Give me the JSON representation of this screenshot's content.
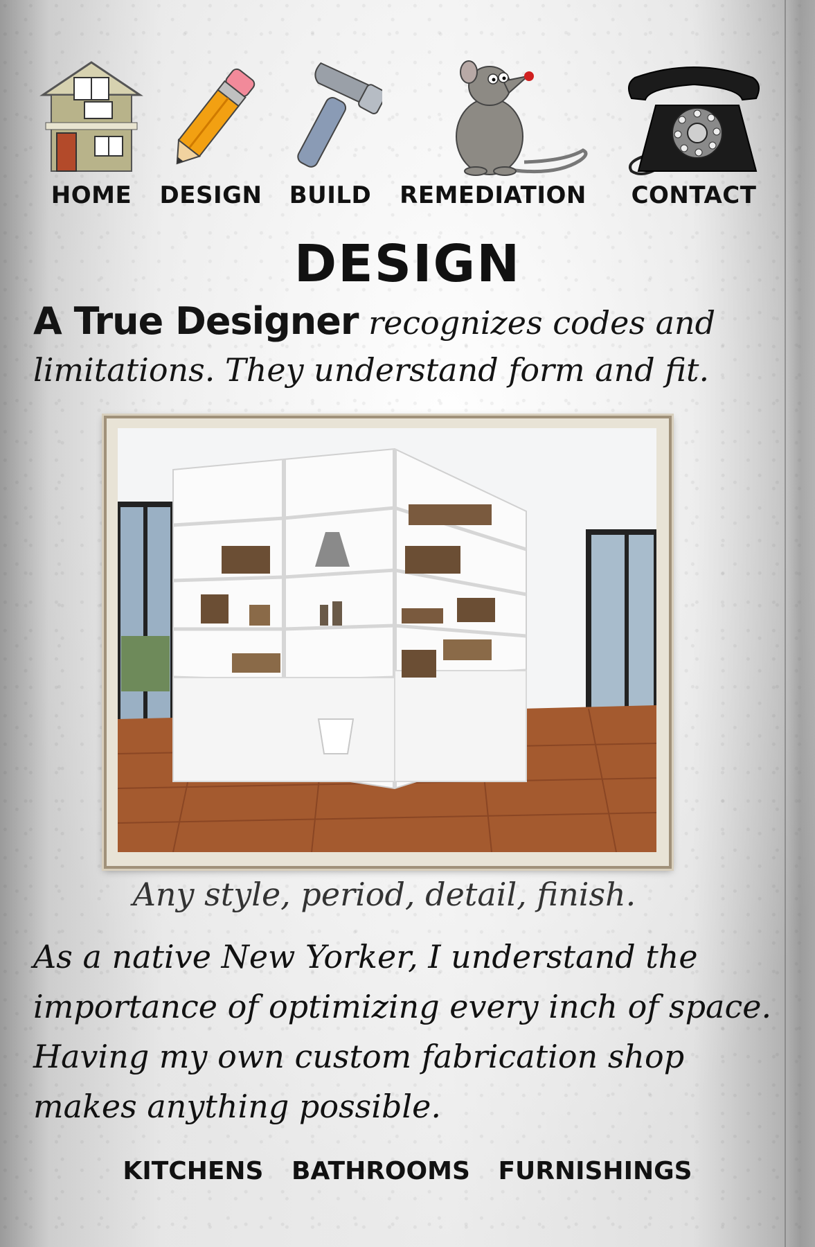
{
  "nav": {
    "items": [
      {
        "label": "HOME",
        "icon": "house-icon"
      },
      {
        "label": "DESIGN",
        "icon": "pencil-icon"
      },
      {
        "label": "BUILD",
        "icon": "hammer-icon"
      },
      {
        "label": "REMEDIATION",
        "icon": "rat-icon"
      },
      {
        "label": "CONTACT",
        "icon": "telephone-icon"
      }
    ]
  },
  "page": {
    "title": "DESIGN",
    "intro_strong": "A True Designer",
    "intro_rest": " recognizes codes and limitations. They understand form and fit.",
    "photo_icon": "bookshelf-photo",
    "caption": "Any style, period, detail, finish.",
    "body": "As a native New Yorker, I understand the importance of optimizing every inch of space. Having my own custom fabrication shop makes anything possible."
  },
  "footer": {
    "links": [
      "KITCHENS",
      "BATHROOMS",
      "FURNISHINGS"
    ]
  },
  "colors": {
    "paper": "#f2f2f2",
    "ink": "#111111",
    "frame": "#a0917a",
    "pencil": "#f2a012",
    "rat_nose": "#d02020"
  }
}
